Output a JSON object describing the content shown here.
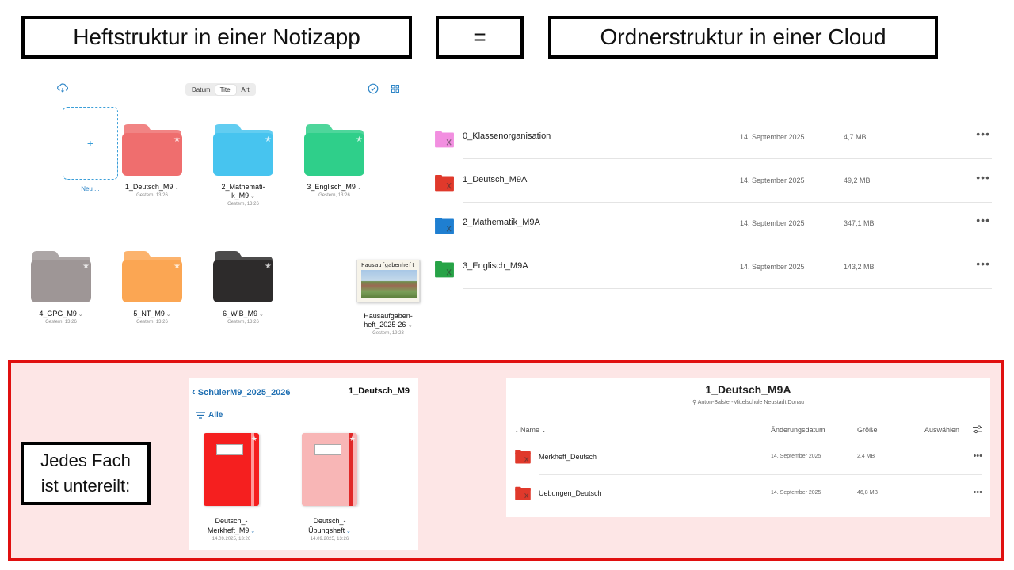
{
  "titles": {
    "left": "Heftstruktur in einer Notizapp",
    "equals": "=",
    "right": "Ordnerstruktur in einer Cloud"
  },
  "notes_app": {
    "segments": [
      "Datum",
      "Titel",
      "Art"
    ],
    "active_segment": "Titel",
    "new_label": "Neu ...",
    "folders": [
      {
        "name": "1_Deutsch_M9",
        "sub": "Gestern, 13:26",
        "color": "#ef6e6e"
      },
      {
        "name": "2_Mathemati-\nk_M9",
        "sub": "Gestern, 13:26",
        "color": "#47c4ef"
      },
      {
        "name": "3_Englisch_M9",
        "sub": "Gestern, 13:26",
        "color": "#2fcf8a"
      },
      {
        "name": "4_GPG_M9",
        "sub": "Gestern, 13:26",
        "color": "#9e9696"
      },
      {
        "name": "5_NT_M9",
        "sub": "Gestern, 13:26",
        "color": "#fba653"
      },
      {
        "name": "6_WiB_M9",
        "sub": "Gestern, 13:26",
        "color": "#2d2b2b"
      }
    ],
    "notebook": {
      "name": "Hausaufgaben-\nheft_2025-26",
      "sub": "Gestern, 19:23",
      "cover_title": "Hausaufgabenheft"
    }
  },
  "cloud_list": [
    {
      "name": "0_Klassenorganisation",
      "date": "14. September 2025",
      "size": "4,7 MB",
      "color": "#f28fe0"
    },
    {
      "name": "1_Deutsch_M9A",
      "date": "14. September 2025",
      "size": "49,2 MB",
      "color": "#e0392b"
    },
    {
      "name": "2_Mathematik_M9A",
      "date": "14. September 2025",
      "size": "347,1 MB",
      "color": "#1f7fd1"
    },
    {
      "name": "3_Englisch_M9A",
      "date": "14. September 2025",
      "size": "143,2 MB",
      "color": "#27a347"
    }
  ],
  "fach_box": {
    "line1": "Jedes Fach",
    "line2": "ist untereilt:"
  },
  "sub_notes": {
    "back": "SchülerM9_2025_2026",
    "title": "1_Deutsch_M9",
    "filter": "Alle",
    "books": [
      {
        "name": "Deutsch_-\nMerkheft_M9",
        "sub": "14.09.2025, 13:26",
        "color": "#f51f1f",
        "strap": "#ff9a9a"
      },
      {
        "name": "Deutsch_-\nÜbungsheft",
        "sub": "14.09.2025, 13:26",
        "color": "#f8b6b6",
        "strap": "#e02828"
      }
    ]
  },
  "sub_cloud": {
    "title": "1_Deutsch_M9A",
    "subtitle": "Anton-Balster-Mittelschule Neustadt Donau",
    "headers": {
      "name": "Name",
      "date": "Änderungsdatum",
      "size": "Größe",
      "select": "Auswählen"
    },
    "rows": [
      {
        "name": "Merkheft_Deutsch",
        "date": "14. September 2025",
        "size": "2,4 MB"
      },
      {
        "name": "Uebungen_Deutsch",
        "date": "14. September 2025",
        "size": "46,8 MB"
      }
    ]
  }
}
